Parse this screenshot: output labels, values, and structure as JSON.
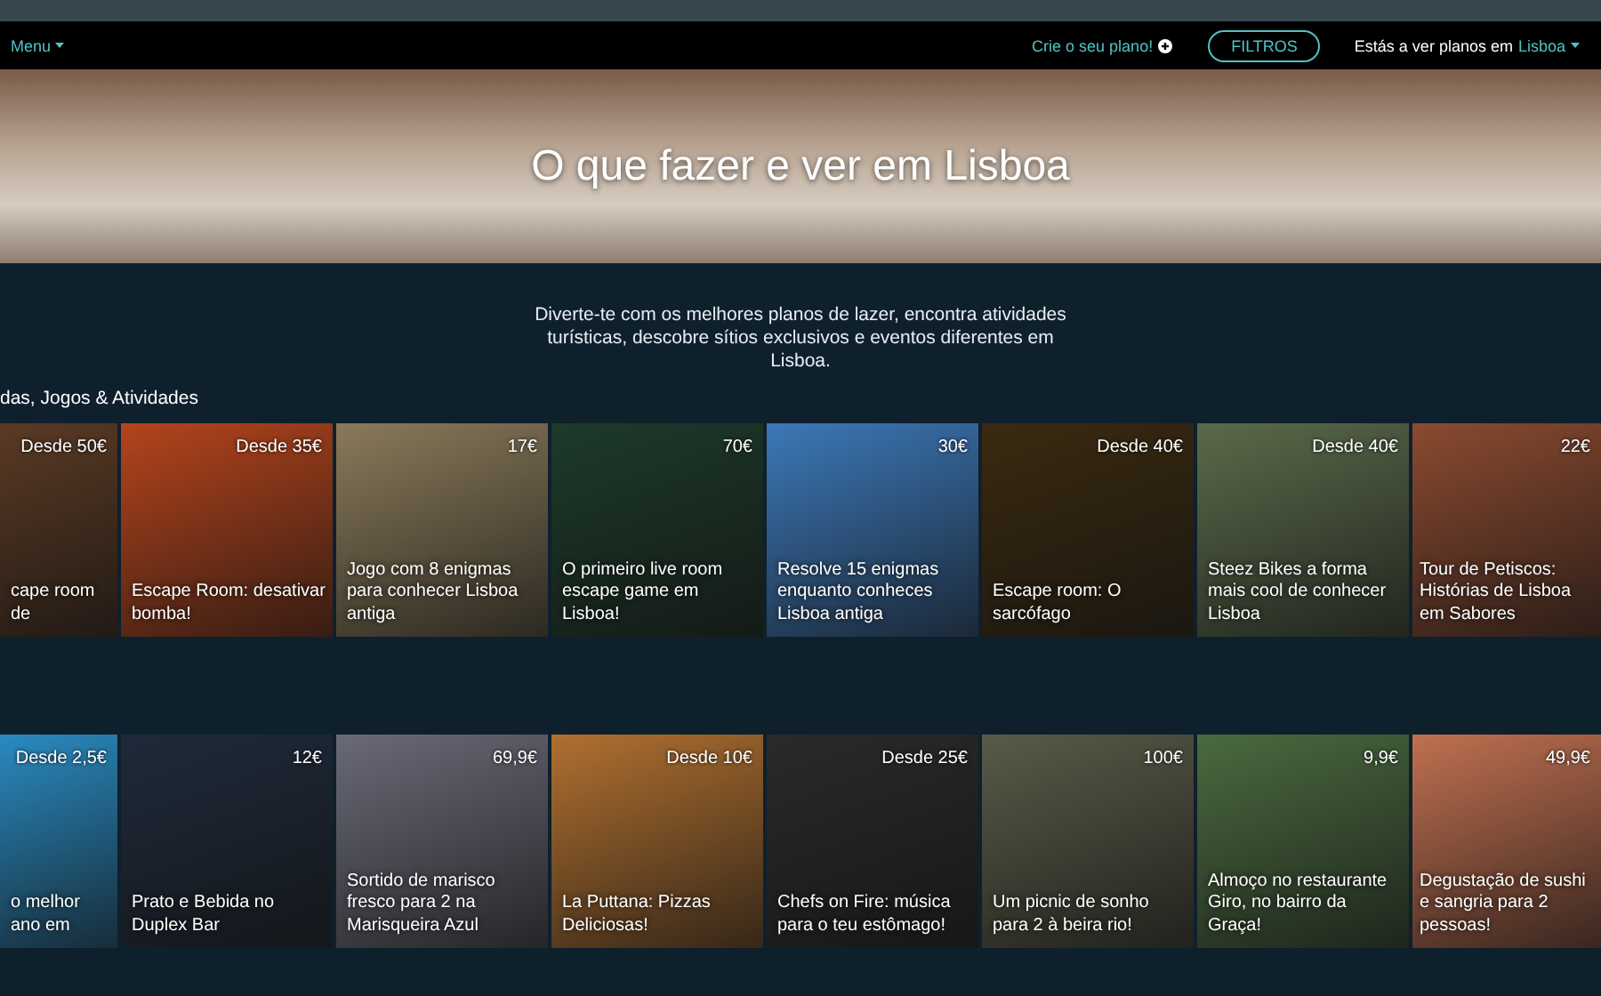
{
  "nav": {
    "menu": "Menu",
    "create_plan": "Crie o seu plano!",
    "filters_button": "FILTROS",
    "location_prefix": "Estás a ver planos em",
    "location": "Lisboa"
  },
  "hero": {
    "title": "O que fazer e ver em Lisboa"
  },
  "intro": "Diverte-te com os melhores planos de lazer, encontra atividades turísticas, descobre sítios exclusivos e eventos diferentes em Lisboa.",
  "sections": [
    {
      "heading": "das, Jogos & Atividades",
      "cards": [
        {
          "price": "Desde 50€",
          "title": "cape room de"
        },
        {
          "price": "Desde 35€",
          "title": "Escape Room: desativar bomba!"
        },
        {
          "price": "17€",
          "title": "Jogo com 8 enigmas para conhecer Lisboa antiga"
        },
        {
          "price": "70€",
          "title": "O primeiro live room escape game em Lisboa!"
        },
        {
          "price": "30€",
          "title": "Resolve 15 enigmas enquanto conheces Lisboa antiga"
        },
        {
          "price": "Desde 40€",
          "title": "Escape room: O sarcófago"
        },
        {
          "price": "Desde 40€",
          "title": "Steez Bikes a forma mais cool de conhecer Lisboa"
        },
        {
          "price": "22€",
          "title": "Tour de Petiscos: Histórias de Lisboa em Sabores"
        }
      ]
    },
    {
      "cards": [
        {
          "price": "Desde 2,5€",
          "title": "o melhor ano em"
        },
        {
          "price": "12€",
          "title": "Prato e Bebida no Duplex Bar"
        },
        {
          "price": "69,9€",
          "title": "Sortido de marisco fresco para 2 na Marisqueira Azul"
        },
        {
          "price": "Desde 10€",
          "title": "La Puttana: Pizzas Deliciosas!"
        },
        {
          "price": "Desde 25€",
          "title": "Chefs on Fire: música para o teu estômago!"
        },
        {
          "price": "100€",
          "title": "Um picnic de sonho para 2 à beira rio!"
        },
        {
          "price": "9,9€",
          "title": "Almoço no restaurante Giro, no bairro da Graça!"
        },
        {
          "price": "49,9€",
          "title": "Degustação de sushi e sangria para 2 pessoas!"
        }
      ]
    }
  ]
}
